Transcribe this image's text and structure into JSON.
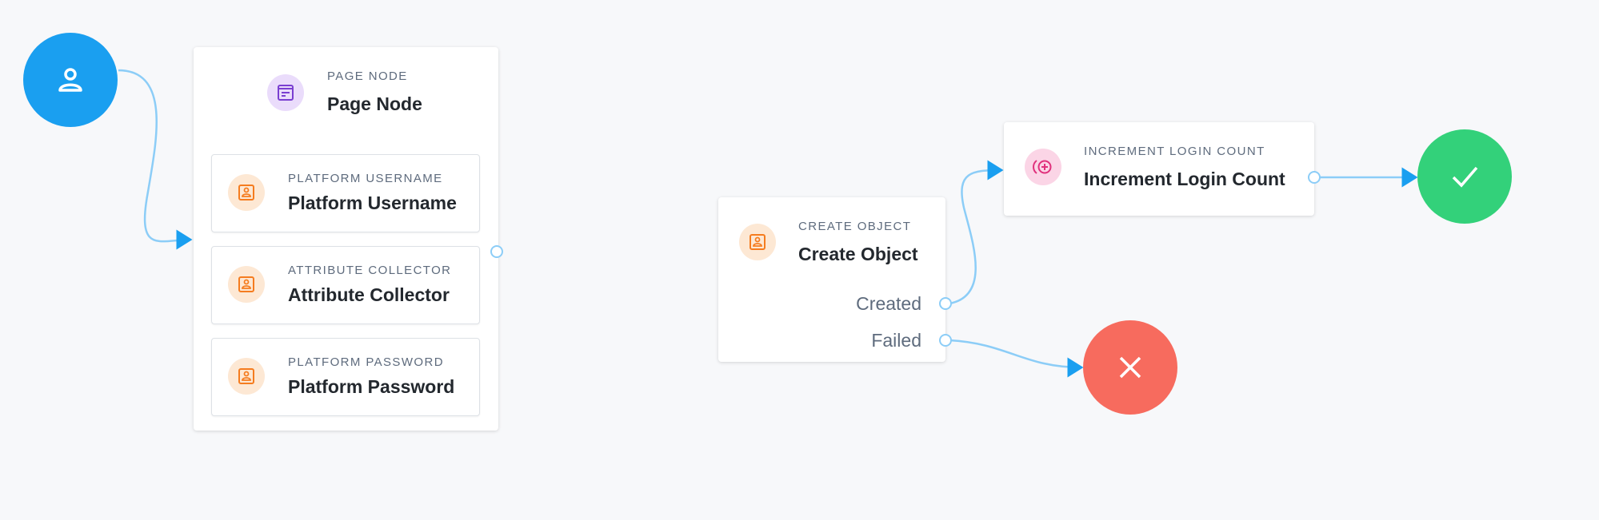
{
  "colors": {
    "start": "#1a9ff0",
    "success": "#33d17a",
    "failure": "#f76b5e",
    "edge": "#8ccdf7",
    "arrow": "#1a9ff0"
  },
  "start_node": {
    "icon": "user-icon"
  },
  "page_node": {
    "label": "PAGE NODE",
    "title": "Page Node",
    "icon": "page-icon",
    "children": [
      {
        "label": "PLATFORM USERNAME",
        "title": "Platform Username",
        "icon": "id-card-icon"
      },
      {
        "label": "ATTRIBUTE COLLECTOR",
        "title": "Attribute Collector",
        "icon": "id-card-icon"
      },
      {
        "label": "PLATFORM PASSWORD",
        "title": "Platform Password",
        "icon": "id-card-icon"
      }
    ]
  },
  "create_object": {
    "label": "CREATE OBJECT",
    "title": "Create Object",
    "icon": "id-card-icon",
    "outcomes": [
      "Created",
      "Failed"
    ]
  },
  "increment": {
    "label": "INCREMENT LOGIN COUNT",
    "title": "Increment Login Count",
    "icon": "increment-icon"
  },
  "success_node": {
    "icon": "check-icon"
  },
  "failure_node": {
    "icon": "x-icon"
  }
}
